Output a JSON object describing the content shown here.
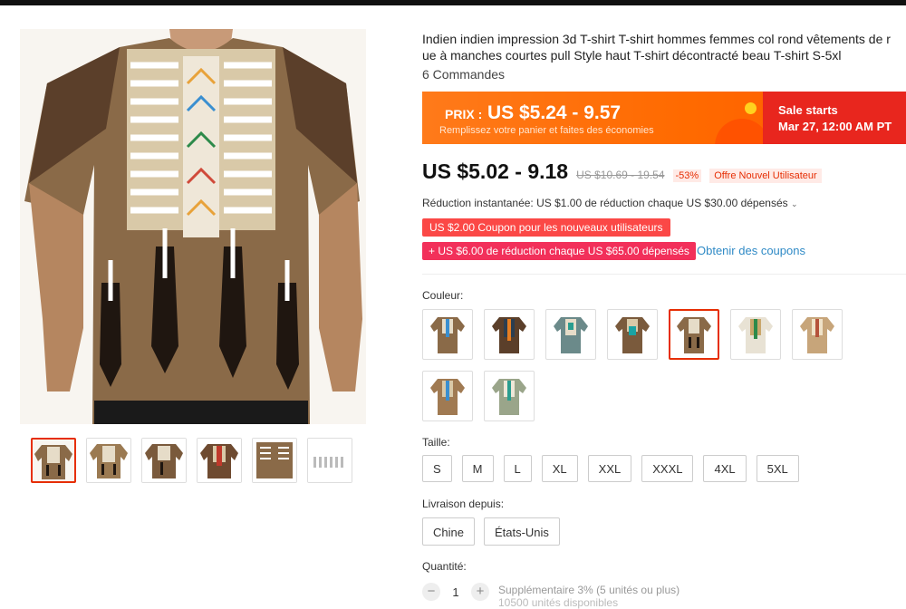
{
  "product": {
    "title": "Indien indien impression 3d T-shirt T-shirt hommes femmes col rond vêtements de r ue à manches courtes pull Style haut T-shirt décontracté beau T-shirt S-5xl",
    "orders": "6 Commandes"
  },
  "banner": {
    "label": "PRIX :",
    "price": "US $5.24 - 9.57",
    "sub": "Remplissez votre panier et faites des économies",
    "sale_title": "Sale starts",
    "sale_date": "Mar 27, 12:00 AM PT"
  },
  "price": {
    "current": "US $5.02 - 9.18",
    "old": "US $10.69 - 19.54",
    "discount": "-53%",
    "tag": "Offre Nouvel Utilisateur"
  },
  "promos": {
    "instant": "Réduction instantanée: US $1.00 de réduction chaque US $30.00 dépensés",
    "coupon1": "US $2.00 Coupon pour les nouveaux utilisateurs",
    "coupon2": "+ US $6.00 de réduction chaque US $65.00 dépensés",
    "get_coupons": "Obtenir des coupons"
  },
  "options": {
    "color_label": "Couleur:",
    "size_label": "Taille:",
    "sizes": [
      "S",
      "M",
      "L",
      "XL",
      "XXL",
      "XXXL",
      "4XL",
      "5XL"
    ],
    "ship_label": "Livraison depuis:",
    "ship_from": [
      "Chine",
      "États-Unis"
    ],
    "qty_label": "Quantité:",
    "qty_value": "1",
    "qty_note": "Supplémentaire 3% (5 unités ou plus)",
    "qty_note2": "10500 unités disponibles"
  },
  "colors": {
    "brand": "#ff6a00",
    "sale": "#e8261e",
    "accent": "#e62e04"
  }
}
